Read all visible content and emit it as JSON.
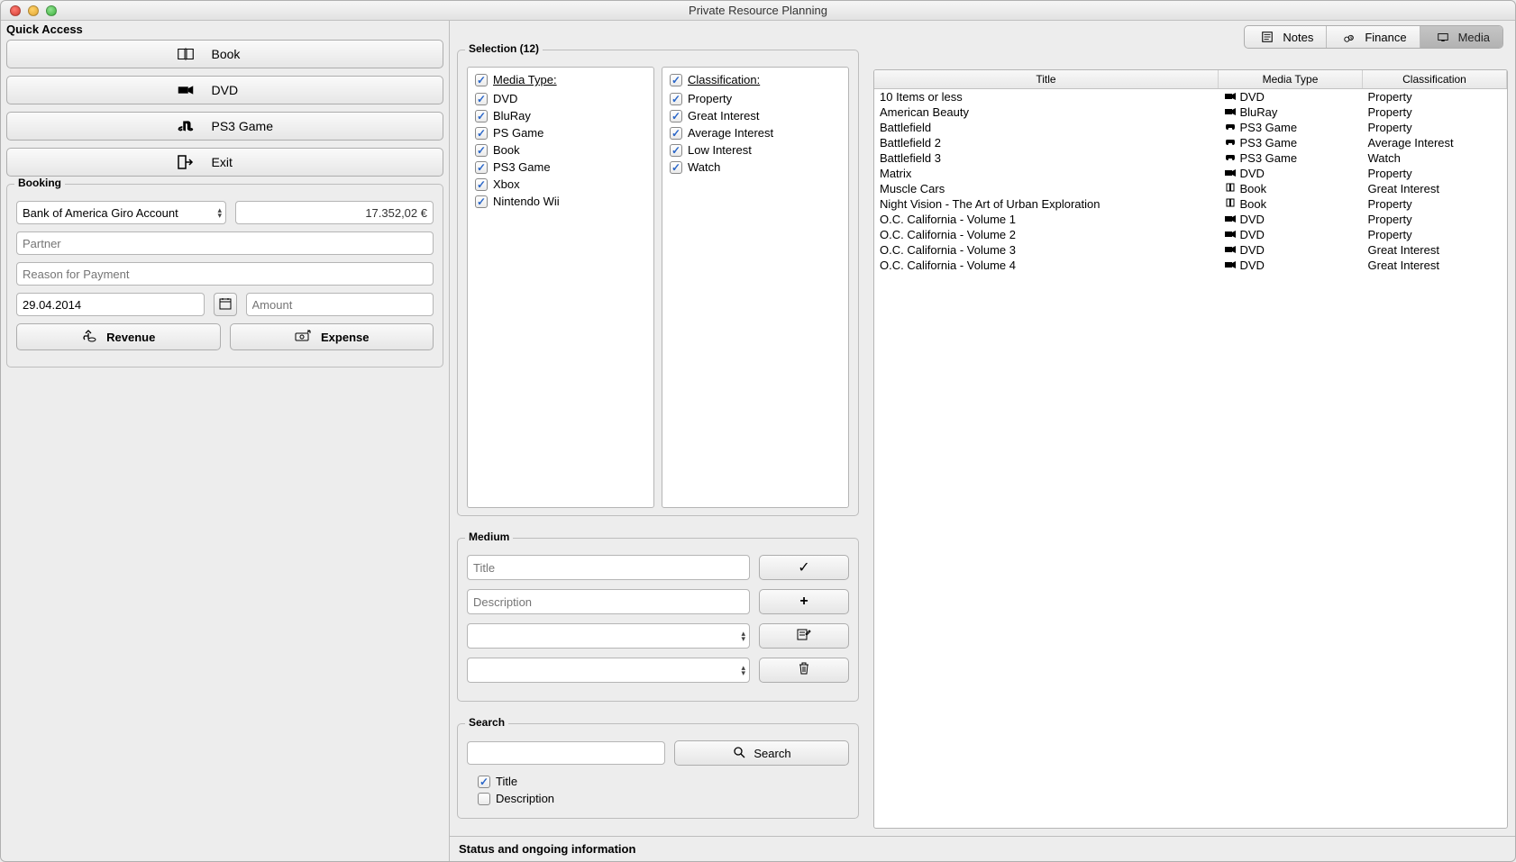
{
  "window_title": "Private Resource Planning",
  "quick_access": {
    "title": "Quick Access",
    "buttons": {
      "book": "Book",
      "dvd": "DVD",
      "ps3": "PS3 Game",
      "exit": "Exit"
    }
  },
  "booking": {
    "title": "Booking",
    "account": "Bank of America Giro Account",
    "balance": "17.352,02 €",
    "partner_ph": "Partner",
    "reason_ph": "Reason for Payment",
    "date": "29.04.2014",
    "amount_ph": "Amount",
    "revenue": "Revenue",
    "expense": "Expense"
  },
  "tabs": {
    "notes": "Notes",
    "finance": "Finance",
    "media": "Media"
  },
  "selection": {
    "title": "Selection (12)",
    "mtype_label": "Media Type:",
    "class_label": "Classification:",
    "mtypes": [
      "DVD",
      "BluRay",
      "PS Game",
      "Book",
      "PS3 Game",
      "Xbox",
      "Nintendo Wii"
    ],
    "classes": [
      "Property",
      "Great Interest",
      "Average Interest",
      "Low Interest",
      "Watch"
    ]
  },
  "medium": {
    "title": "Medium",
    "title_ph": "Title",
    "desc_ph": "Description"
  },
  "search": {
    "title": "Search",
    "btn": "Search",
    "chk_title": "Title",
    "chk_desc": "Description"
  },
  "table": {
    "cols": {
      "title": "Title",
      "mtype": "Media Type",
      "class": "Classification"
    },
    "rows": [
      {
        "title": "10 Items or less",
        "mtype": "DVD",
        "class": "Property"
      },
      {
        "title": "American Beauty",
        "mtype": "BluRay",
        "class": "Property"
      },
      {
        "title": "Battlefield",
        "mtype": "PS3 Game",
        "class": "Property"
      },
      {
        "title": "Battlefield 2",
        "mtype": "PS3 Game",
        "class": "Average Interest"
      },
      {
        "title": "Battlefield 3",
        "mtype": "PS3 Game",
        "class": "Watch"
      },
      {
        "title": "Matrix",
        "mtype": "DVD",
        "class": "Property"
      },
      {
        "title": "Muscle Cars",
        "mtype": "Book",
        "class": "Great Interest"
      },
      {
        "title": "Night Vision - The Art of Urban Exploration",
        "mtype": "Book",
        "class": "Property"
      },
      {
        "title": "O.C. California - Volume 1",
        "mtype": "DVD",
        "class": "Property"
      },
      {
        "title": "O.C. California - Volume 2",
        "mtype": "DVD",
        "class": "Property"
      },
      {
        "title": "O.C. California - Volume 3",
        "mtype": "DVD",
        "class": "Great Interest"
      },
      {
        "title": "O.C. California - Volume 4",
        "mtype": "DVD",
        "class": "Great Interest"
      }
    ]
  },
  "status": "Status and ongoing information"
}
